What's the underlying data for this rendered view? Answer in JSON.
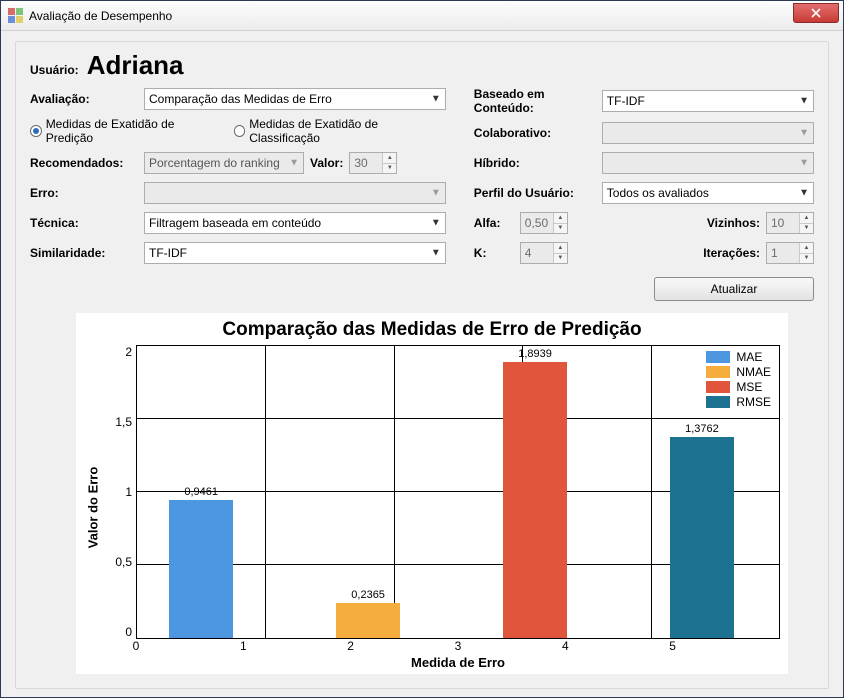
{
  "window": {
    "title": "Avaliação de Desempenho"
  },
  "user": {
    "label": "Usuário:",
    "name": "Adriana"
  },
  "left": {
    "avaliacao_label": "Avaliação:",
    "avaliacao_value": "Comparação das Medidas de Erro",
    "radio1": "Medidas de Exatidão de Predição",
    "radio2": "Medidas de Exatidão de Classificação",
    "recomendados_label": "Recomendados:",
    "recomendados_value": "Porcentagem do ranking",
    "valor_label": "Valor:",
    "valor_value": "30",
    "erro_label": "Erro:",
    "erro_value": "",
    "tecnica_label": "Técnica:",
    "tecnica_value": "Filtragem baseada em conteúdo",
    "similaridade_label": "Similaridade:",
    "similaridade_value": "TF-IDF"
  },
  "right": {
    "baseado_label": "Baseado em Conteúdo:",
    "baseado_value": "TF-IDF",
    "colaborativo_label": "Colaborativo:",
    "colaborativo_value": "",
    "hibrido_label": "Híbrido:",
    "hibrido_value": "",
    "perfil_label": "Perfil do Usuário:",
    "perfil_value": "Todos os avaliados",
    "alfa_label": "Alfa:",
    "alfa_value": "0,50",
    "vizinhos_label": "Vizinhos:",
    "vizinhos_value": "10",
    "k_label": "K:",
    "k_value": "4",
    "iteracoes_label": "Iterações:",
    "iteracoes_value": "1"
  },
  "buttons": {
    "atualizar": "Atualizar"
  },
  "chart_data": {
    "type": "bar",
    "title": "Comparação das Medidas de Erro de Predição",
    "xlabel": "Medida de Erro",
    "ylabel": "Valor do Erro",
    "ylim": [
      0,
      2
    ],
    "yticks": [
      "2",
      "1,5",
      "1",
      "0,5",
      "0"
    ],
    "xticks": [
      "0",
      "1",
      "2",
      "3",
      "4",
      "5"
    ],
    "series": [
      {
        "name": "MAE",
        "color": "#4d97e0",
        "x": 0.5,
        "value": 0.9461,
        "label": "0,9461"
      },
      {
        "name": "NMAE",
        "color": "#f5ae3d",
        "x": 1.8,
        "value": 0.2365,
        "label": "0,2365"
      },
      {
        "name": "MSE",
        "color": "#e0553b",
        "x": 3.1,
        "value": 1.8939,
        "label": "1,8939"
      },
      {
        "name": "RMSE",
        "color": "#1d7291",
        "x": 4.4,
        "value": 1.3762,
        "label": "1,3762"
      }
    ],
    "xmax": 5,
    "bar_width": 0.5,
    "legend_pos": {
      "right": 8,
      "top": 4
    }
  }
}
